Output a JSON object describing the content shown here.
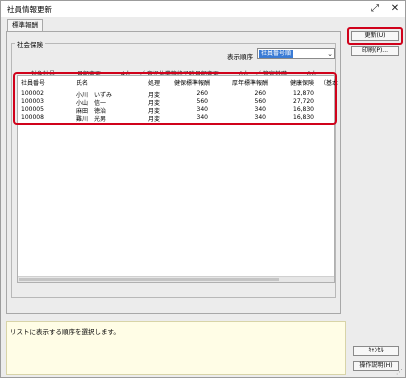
{
  "window": {
    "title": "社員情報更新"
  },
  "tabs": [
    {
      "label": "標準報酬"
    }
  ],
  "group": {
    "title": "社会保険"
  },
  "order": {
    "label": "表示順序",
    "selected": "社員番号順"
  },
  "counts": {
    "target_label": "対象社員：",
    "monthly_label": "月額変更",
    "monthly_count": "4人",
    "leave_label": "／ 育児休業等終了時月額変更",
    "leave_count": "0人",
    "base_label": "／ 算定基礎",
    "base_count": "0人"
  },
  "grid": {
    "headers": [
      "社員番号",
      "氏名",
      "処理",
      "健保標準報酬",
      "厚年標準報酬",
      "健康保険",
      "（基本"
    ],
    "rows": [
      {
        "id": "100002",
        "name": "小川　いずみ",
        "process": "月変",
        "kenpo_std": "260",
        "kounen_std": "260",
        "health": "12,870"
      },
      {
        "id": "100003",
        "name": "小山　信一",
        "process": "月変",
        "kenpo_std": "560",
        "kounen_std": "560",
        "health": "27,720"
      },
      {
        "id": "100005",
        "name": "麻田　徳治",
        "process": "月変",
        "kenpo_std": "340",
        "kounen_std": "340",
        "health": "16,830"
      },
      {
        "id": "100008",
        "name": "難川　光男",
        "process": "月変",
        "kenpo_std": "340",
        "kounen_std": "340",
        "health": "16,830"
      }
    ]
  },
  "buttons": {
    "update": "更新(U)",
    "print": "印刷(P)...",
    "cancel": "ｷｬﾝｾﾙ",
    "help": "操作説明(H)"
  },
  "hint": {
    "text": "リストに表示する順序を選択します。"
  }
}
